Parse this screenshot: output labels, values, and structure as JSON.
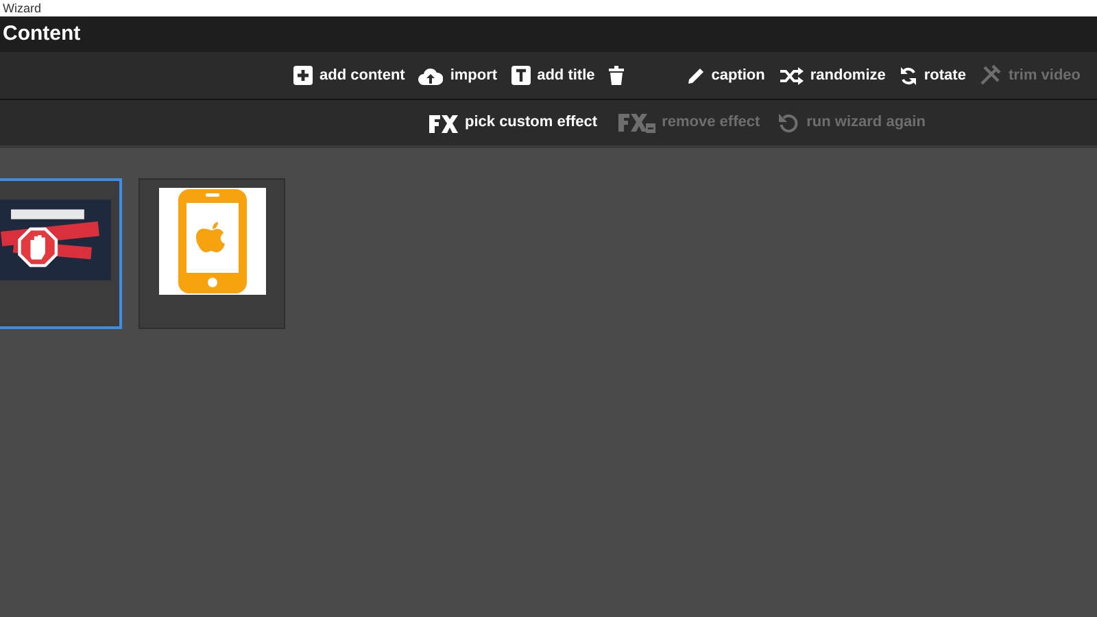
{
  "window": {
    "title": "Wizard"
  },
  "header": {
    "title": "Content"
  },
  "toolbar": [
    {
      "kind": "add",
      "label": "add content",
      "disabled": false
    },
    {
      "kind": "import",
      "label": "import",
      "disabled": false
    },
    {
      "kind": "title",
      "label": "add title",
      "disabled": false
    },
    {
      "kind": "delete",
      "disabled": false
    },
    {
      "kind": "caption",
      "label": "caption",
      "disabled": false
    },
    {
      "kind": "randomize",
      "label": "randomize",
      "disabled": false
    },
    {
      "kind": "rotate",
      "label": "rotate",
      "disabled": false
    },
    {
      "kind": "trim",
      "label": "trim video",
      "disabled": true
    }
  ],
  "effects_bar": [
    {
      "kind": "fx",
      "label": "pick custom effect",
      "disabled": false
    },
    {
      "kind": "fxremove",
      "label": "remove effect",
      "disabled": true
    },
    {
      "kind": "rerun",
      "label": "run wizard again",
      "disabled": true
    }
  ],
  "items": [
    {
      "kind": "ad-image",
      "selected": true
    },
    {
      "kind": "phone-image",
      "selected": false
    }
  ]
}
